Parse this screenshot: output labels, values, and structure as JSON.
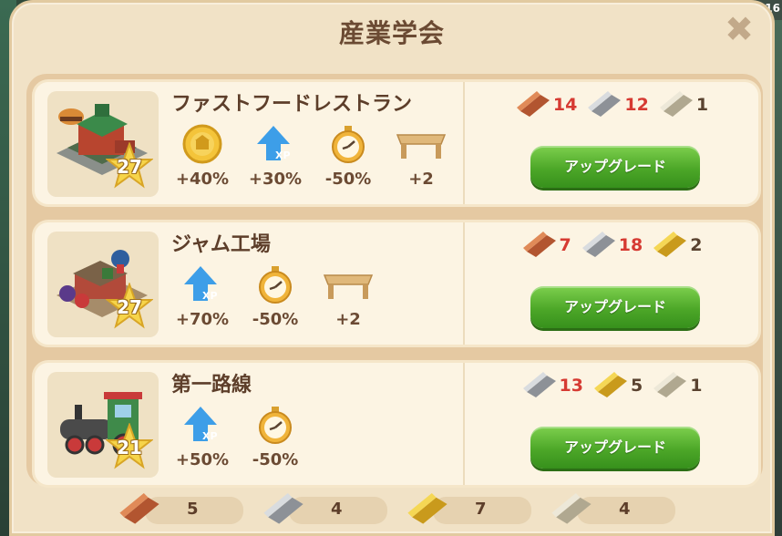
{
  "panel": {
    "title": "産業学会",
    "close_icon": "close-icon"
  },
  "corner_text": "16",
  "colors": {
    "copper": "#c8663c",
    "silver": "#b6b9bd",
    "gold": "#e8c43a",
    "platinum": "#d8d2c2",
    "insufficient": "#d63a32",
    "button_green": "#4ca728"
  },
  "rows": [
    {
      "name": "ファストフードレストラン",
      "level": "27",
      "bonuses": [
        {
          "icon": "coin-icon",
          "value": "+40%"
        },
        {
          "icon": "xp-arrow-icon",
          "value": "+30%"
        },
        {
          "icon": "stopwatch-icon",
          "value": "-50%"
        },
        {
          "icon": "table-icon",
          "value": "+2"
        }
      ],
      "costs": [
        {
          "icon": "copper-bar-icon",
          "amount": "14",
          "insufficient": true
        },
        {
          "icon": "silver-bar-icon",
          "amount": "12",
          "insufficient": true
        },
        {
          "icon": "platinum-bar-icon",
          "amount": "1",
          "insufficient": false
        }
      ],
      "button": "アップグレード"
    },
    {
      "name": "ジャム工場",
      "level": "27",
      "bonuses": [
        {
          "icon": "xp-arrow-icon",
          "value": "+70%"
        },
        {
          "icon": "stopwatch-icon",
          "value": "-50%"
        },
        {
          "icon": "table-icon",
          "value": "+2"
        }
      ],
      "costs": [
        {
          "icon": "copper-bar-icon",
          "amount": "7",
          "insufficient": true
        },
        {
          "icon": "silver-bar-icon",
          "amount": "18",
          "insufficient": true
        },
        {
          "icon": "gold-bar-icon",
          "amount": "2",
          "insufficient": false
        }
      ],
      "button": "アップグレード"
    },
    {
      "name": "第一路線",
      "level": "21",
      "bonuses": [
        {
          "icon": "xp-arrow-icon",
          "value": "+50%"
        },
        {
          "icon": "stopwatch-icon",
          "value": "-50%"
        }
      ],
      "costs": [
        {
          "icon": "silver-bar-icon",
          "amount": "13",
          "insufficient": true
        },
        {
          "icon": "gold-bar-icon",
          "amount": "5",
          "insufficient": false
        },
        {
          "icon": "platinum-bar-icon",
          "amount": "1",
          "insufficient": false
        }
      ],
      "button": "アップグレード"
    }
  ],
  "inventory": [
    {
      "icon": "copper-bar-icon",
      "amount": "5"
    },
    {
      "icon": "silver-bar-icon",
      "amount": "4"
    },
    {
      "icon": "gold-bar-icon",
      "amount": "7"
    },
    {
      "icon": "platinum-bar-icon",
      "amount": "4"
    }
  ]
}
